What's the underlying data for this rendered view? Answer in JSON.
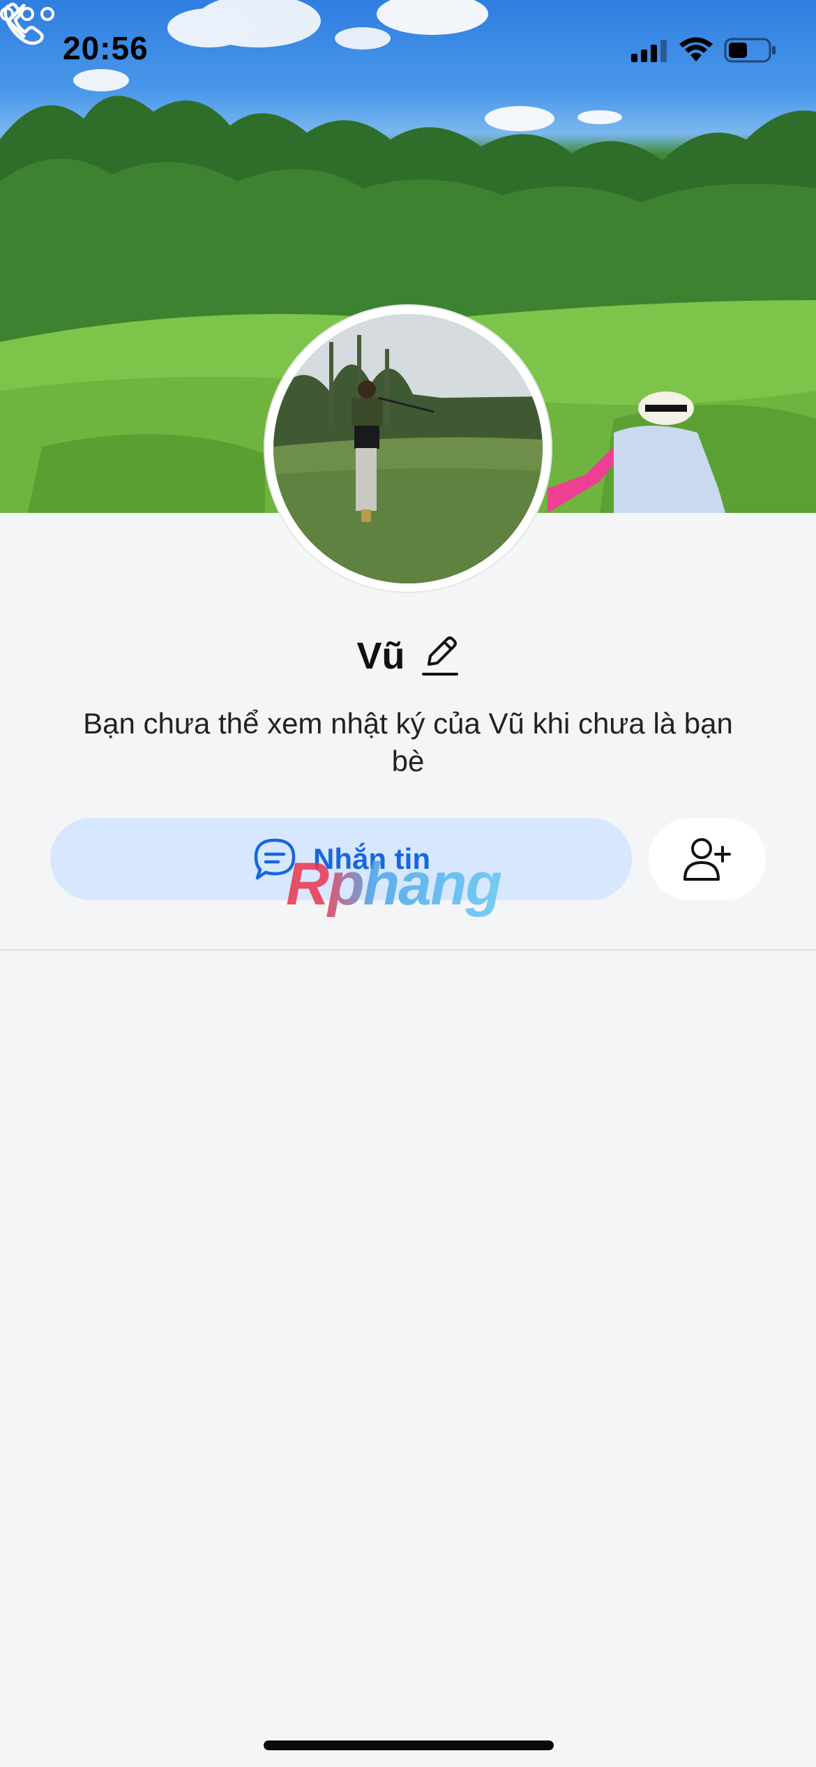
{
  "status_bar": {
    "time": "20:56",
    "icons": [
      "signal-icon",
      "wifi-icon",
      "battery-icon"
    ]
  },
  "nav": {
    "back_icon": "chevron-left-icon",
    "call_icon": "phone-icon",
    "more_icon": "more-dots-icon"
  },
  "profile": {
    "name": "Vũ",
    "edit_icon": "pencil-icon",
    "notice": "Bạn chưa thể xem nhật ký của Vũ khi chưa là bạn bè"
  },
  "actions": {
    "message_label": "Nhắn tin",
    "message_icon": "chat-bubble-icon",
    "add_friend_icon": "add-friend-icon"
  },
  "watermark": "Rphang",
  "colors": {
    "accent": "#1766e0",
    "message_button_bg": "#d7e7fd",
    "page_bg": "#f4f5f7"
  }
}
